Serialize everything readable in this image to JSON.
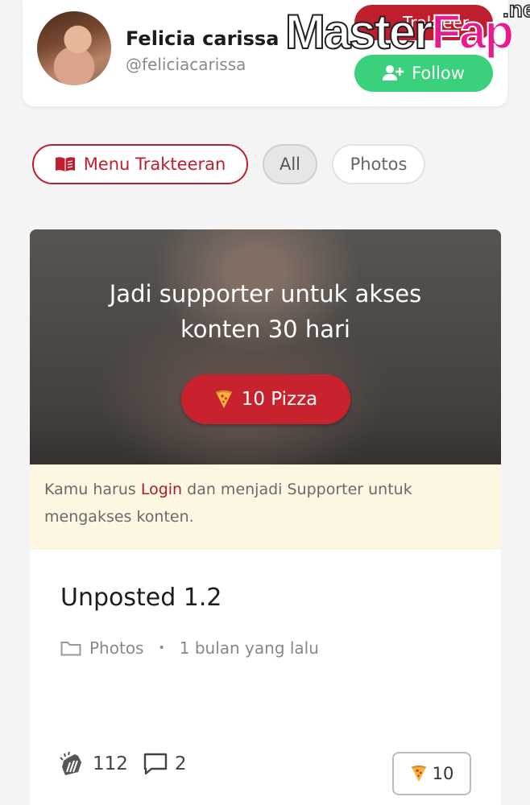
{
  "profile": {
    "name": "Felicia carissa",
    "handle": "@feliciacarissa",
    "trakteer_label": "Trakteer",
    "follow_label": "Follow"
  },
  "watermark": {
    "master": "Master",
    "fap": "Fap",
    "net": ".net"
  },
  "filters": {
    "menu_label": "Menu Trakteeran",
    "all_label": "All",
    "photos_label": "Photos",
    "selected": "All"
  },
  "post": {
    "locked_title_line1": "Jadi supporter untuk akses",
    "locked_title_line2": "konten 30 hari",
    "pizza_label": "10 Pizza",
    "notice_before": "Kamu harus ",
    "notice_login": "Login",
    "notice_after": " dan menjadi Supporter untuk mengakses konten.",
    "title": "Unposted 1.2",
    "category": "Photos",
    "time_ago": "1 bulan yang lalu",
    "likes": "112",
    "comments": "2",
    "tip_count": "10"
  },
  "colors": {
    "brand_red": "#be1e2d",
    "follow_green": "#3bd17c",
    "notice_bg": "#fdf6e3"
  },
  "icons": [
    "avatar",
    "user-plus-icon",
    "book-icon",
    "pizza-icon",
    "folder-icon",
    "clap-icon",
    "comment-icon"
  ]
}
